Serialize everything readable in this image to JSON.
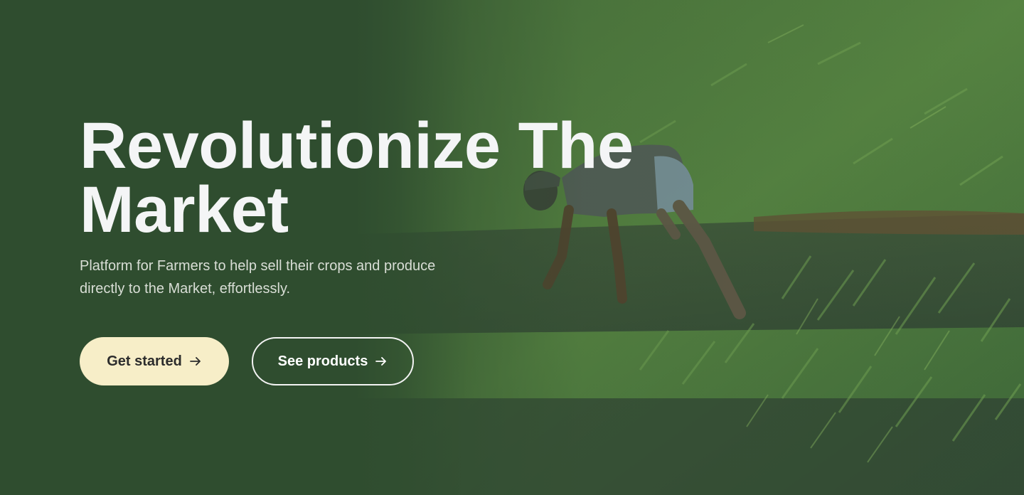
{
  "hero": {
    "headline_line1": "Revolutionize The",
    "headline_line2": "Market",
    "subtitle": "Platform for Farmers to help sell their crops and produce directly to the Market, effortlessly.",
    "background_icon": "rice-field-farmer-photo"
  },
  "actions": {
    "primary_label": "Get started",
    "secondary_label": "See products",
    "arrow_icon": "arrow-right-icon"
  },
  "colors": {
    "background": "#2f4d2f",
    "primary_button": "#f7eec8",
    "headline": "#f4f5f6"
  }
}
